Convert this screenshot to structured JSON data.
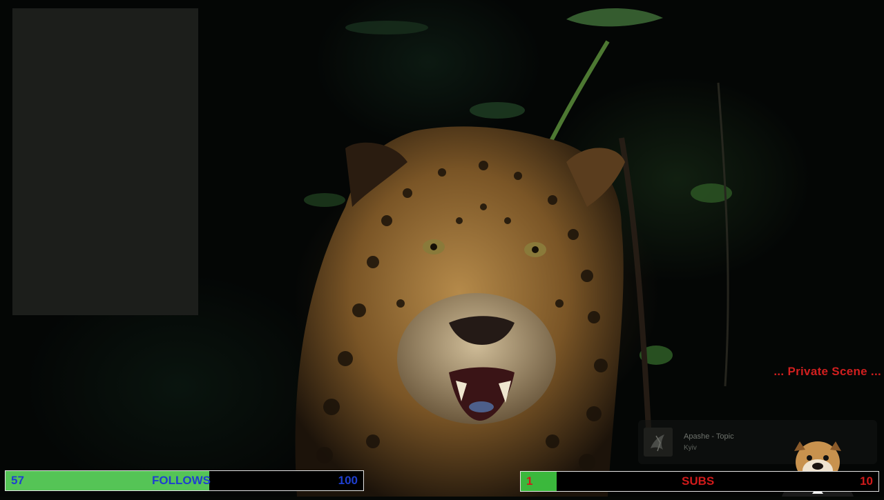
{
  "overlay": {
    "scene_label": "... Private Scene ...",
    "now_playing": {
      "title": "Apashe - Topic",
      "subtitle": "Kyiv",
      "cover_icon": "album-cover-icon"
    },
    "follows_goal": {
      "current": "57",
      "label": "FOLLOWS",
      "target": "100",
      "progress": 0.57
    },
    "subs_goal": {
      "current": "1",
      "label": "SUBS",
      "target": "10",
      "progress": 0.1
    },
    "mascot_icon": "bulldog-mascot-icon"
  },
  "colors": {
    "follows_fill": "#55c456",
    "subs_fill": "#3bb83c",
    "follows_text": "#1f3fd0",
    "subs_text": "#d11a1a",
    "scene_label": "#d21f1f"
  }
}
